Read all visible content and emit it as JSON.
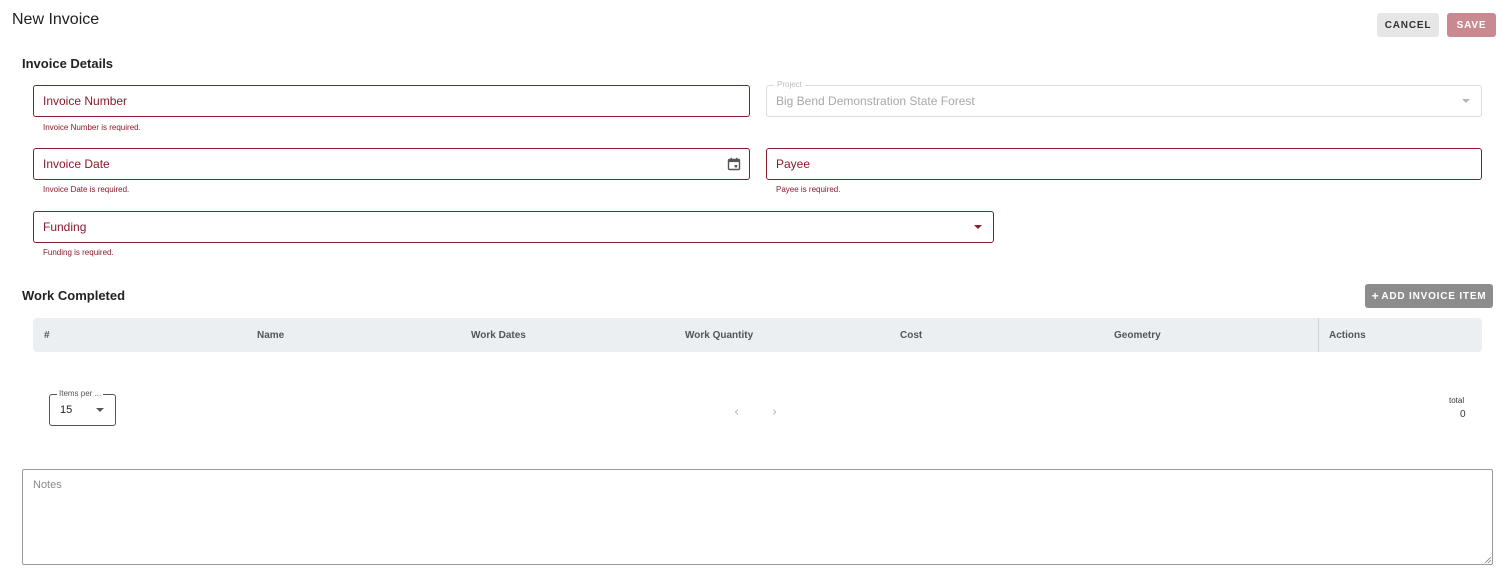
{
  "page": {
    "title": "New Invoice"
  },
  "toolbar": {
    "cancel_label": "CANCEL",
    "save_label": "SAVE"
  },
  "details": {
    "title": "Invoice Details",
    "invoice_number": {
      "label": "Invoice Number",
      "error": "Invoice Number is required."
    },
    "project": {
      "label": "Project",
      "value": "Big Bend Demonstration State Forest"
    },
    "invoice_date": {
      "label": "Invoice Date",
      "error": "Invoice Date is required."
    },
    "payee": {
      "label": "Payee",
      "error": "Payee is required."
    },
    "funding": {
      "label": "Funding",
      "error": "Funding is required."
    }
  },
  "work": {
    "title": "Work Completed",
    "add_label": "ADD INVOICE ITEM",
    "columns": [
      "#",
      "Name",
      "Work Dates",
      "Work Quantity",
      "Cost",
      "Geometry",
      "Actions"
    ],
    "rows": []
  },
  "pagination": {
    "per_page_label": "Items per ...",
    "per_page_value": "15",
    "total_label": "total",
    "total_value": "0"
  },
  "notes": {
    "placeholder": "Notes"
  },
  "colors": {
    "error": "#8b1a2b",
    "save_disabled": "#c98a8f",
    "add_button": "#8c8c8c"
  },
  "icons": [
    "calendar-icon",
    "chevron-down-icon",
    "chevron-left-icon",
    "chevron-right-icon",
    "plus-icon"
  ]
}
